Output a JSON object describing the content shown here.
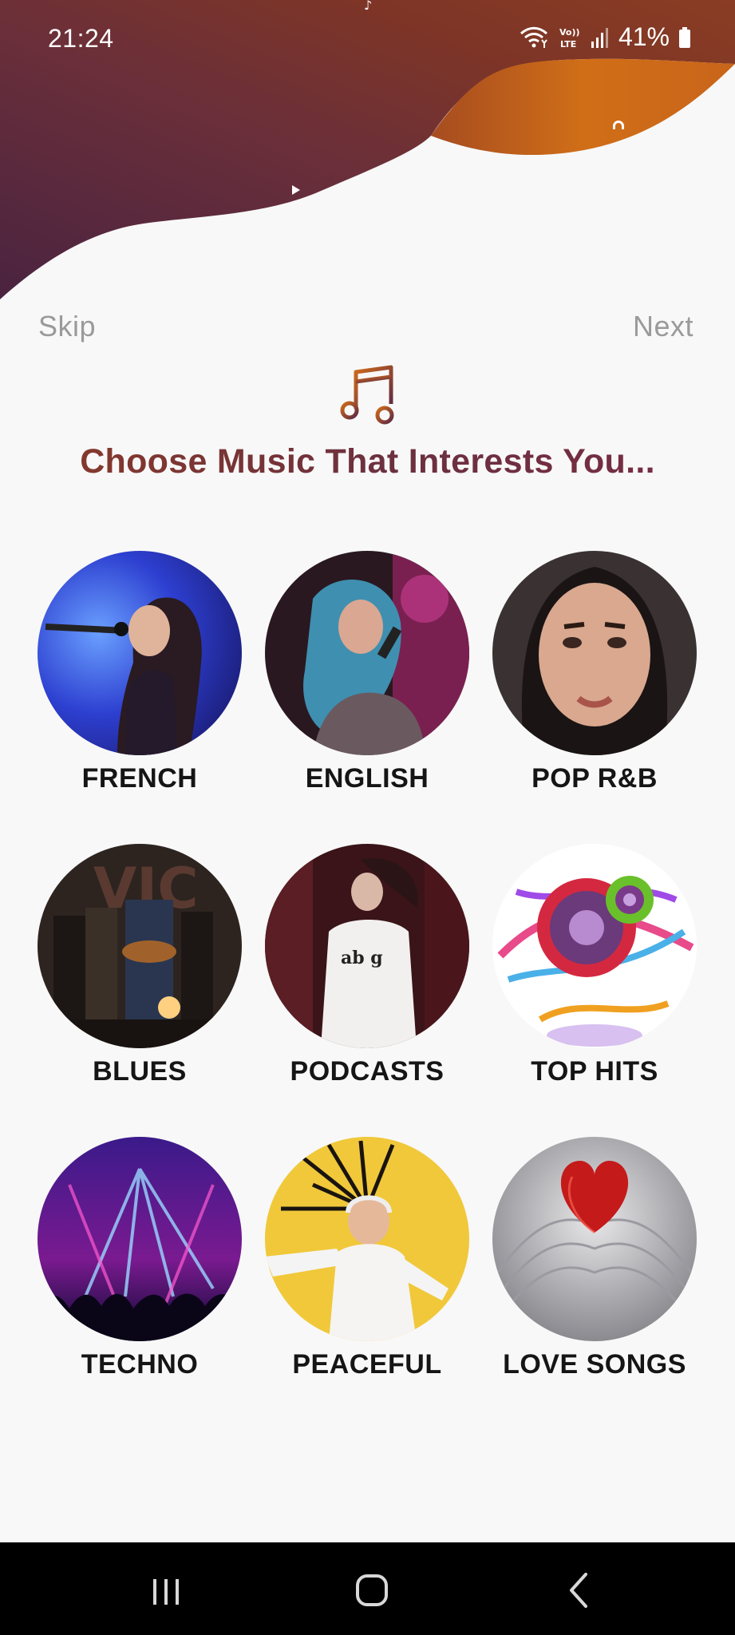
{
  "status_bar": {
    "time": "21:24",
    "battery_percent": "41%",
    "network_label": "Vo)) LTE",
    "icons": [
      "wifi-icon",
      "volte-icon",
      "signal-icon",
      "battery-icon"
    ]
  },
  "header": {
    "skip_label": "Skip",
    "next_label": "Next",
    "gradient_colors": [
      "#4a2340",
      "#7a3528",
      "#c96a1c"
    ]
  },
  "main": {
    "icon": "music-note-icon",
    "title": "Choose Music That Interests You...",
    "accent_color": "#7a3a2e",
    "genres": [
      {
        "label": "FRENCH"
      },
      {
        "label": "ENGLISH"
      },
      {
        "label": "POP R&B"
      },
      {
        "label": "BLUES"
      },
      {
        "label": "PODCASTS"
      },
      {
        "label": "TOP HITS"
      },
      {
        "label": "TECHNO"
      },
      {
        "label": "PEACEFUL"
      },
      {
        "label": "LOVE SONGS"
      }
    ]
  },
  "navigation_bar": {
    "buttons": [
      "recents-icon",
      "home-icon",
      "back-icon"
    ]
  }
}
